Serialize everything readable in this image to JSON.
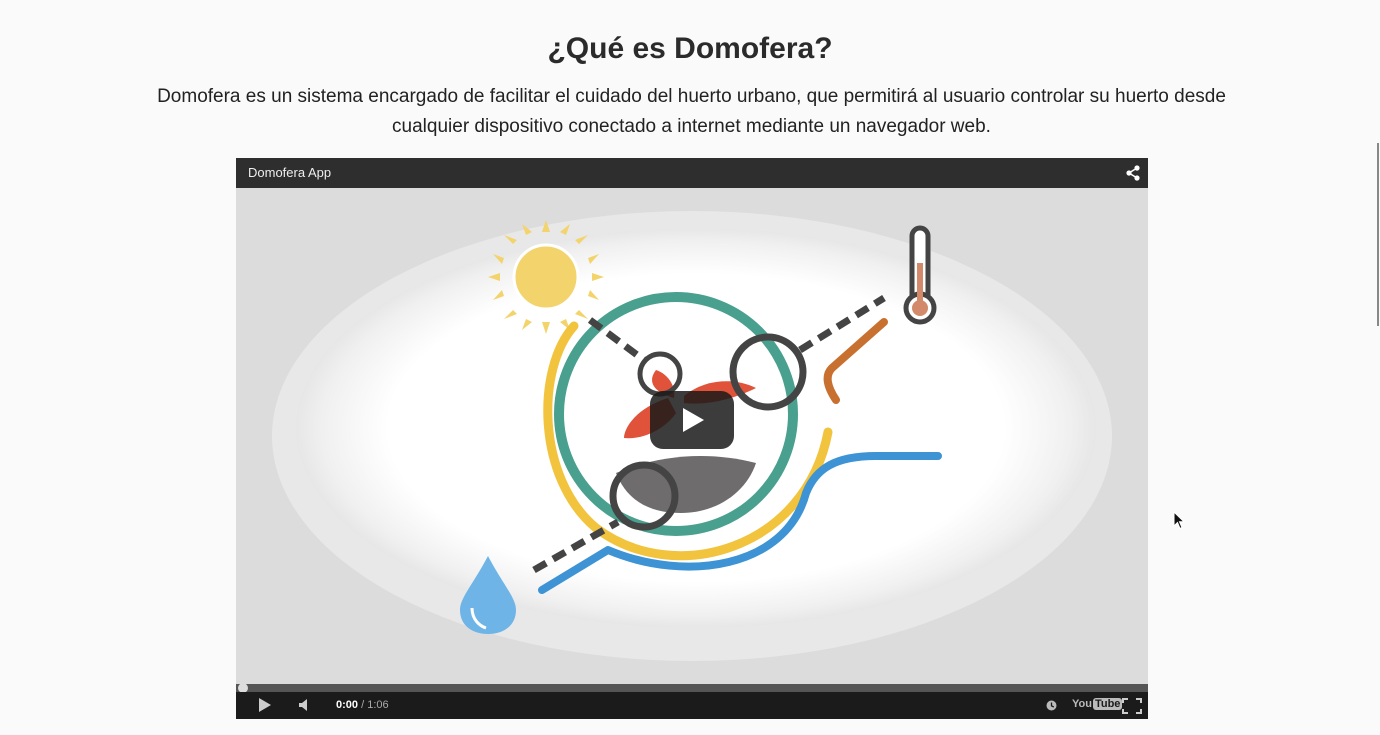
{
  "header": {
    "title": "¿Qué es Domofera?",
    "description": "Domofera es un sistema encargado de facilitar el cuidado del huerto urbano, que permitirá al usuario controlar su huerto desde cualquier dispositivo conectado a internet mediante un navegador web."
  },
  "video": {
    "title": "Domofera App",
    "current_time": "0:00",
    "duration": " / 1:06",
    "progress": 0,
    "logo_you": "You",
    "logo_tube": "Tube",
    "icons": [
      "share-icon",
      "play-icon",
      "volume-icon",
      "watch-later-icon",
      "fullscreen-icon",
      "big-play-icon"
    ]
  },
  "colors": {
    "teal": "#4aa08e",
    "yellow": "#f2c33c",
    "blue": "#3d93d4",
    "orange": "#c8702f",
    "dark": "#444444",
    "red": "#e0523a",
    "sun": "#f3d36c"
  }
}
